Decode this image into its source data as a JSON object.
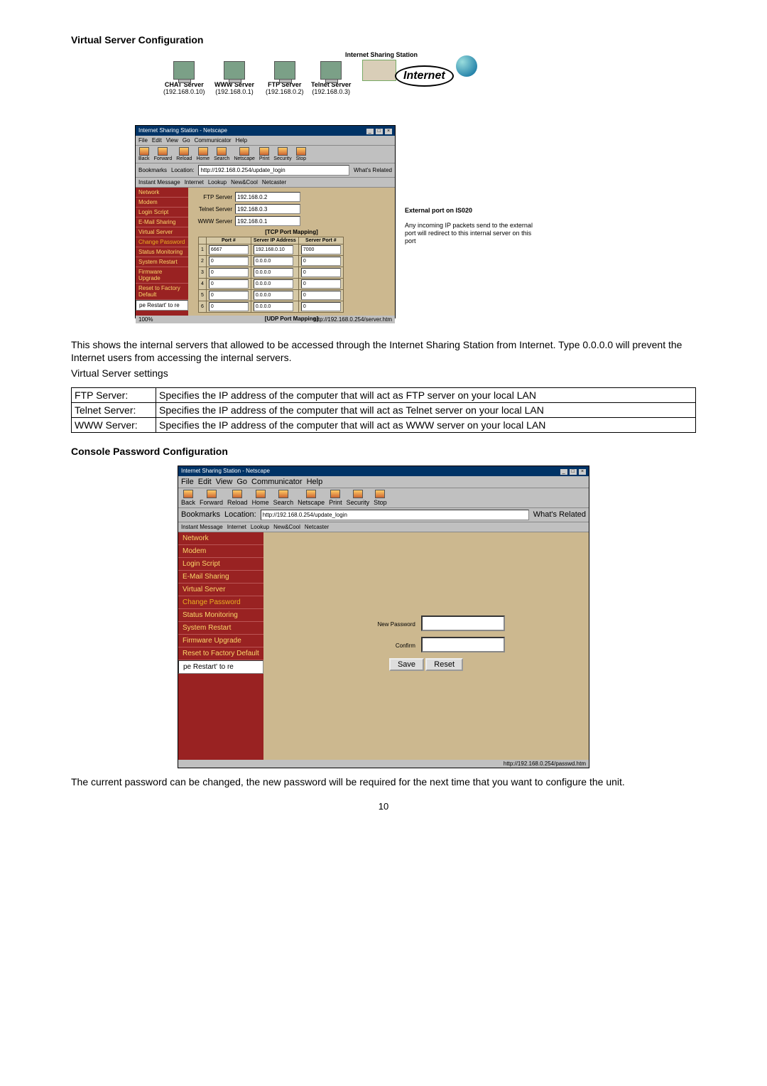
{
  "section1_title": "Virtual Server Configuration",
  "diagram": {
    "iss_label": "Internet Sharing Station",
    "internet_label": "Internet",
    "servers": [
      {
        "name": "CHAT Server",
        "ip": "(192.168.0.10)"
      },
      {
        "name": "WWW Server",
        "ip": "(192.168.0.1)"
      },
      {
        "name": "FTP Server",
        "ip": "(192.168.0.2)"
      },
      {
        "name": "Telnet Server",
        "ip": "(192.168.0.3)"
      }
    ]
  },
  "browser": {
    "title": "Internet Sharing Station - Netscape",
    "win_min": "_",
    "win_max": "□",
    "win_close": "×",
    "menu": [
      "File",
      "Edit",
      "View",
      "Go",
      "Communicator",
      "Help"
    ],
    "toolbar": [
      "Back",
      "Forward",
      "Reload",
      "Home",
      "Search",
      "Netscape",
      "Print",
      "Security",
      "Stop"
    ],
    "bookmarks_label": "Bookmarks",
    "location_label": "Location:",
    "location_value": "http://192.168.0.254/update_login",
    "whats_related": "What's Related",
    "linkbar": [
      "Instant Message",
      "Internet",
      "Lookup",
      "New&Cool",
      "Netcaster"
    ],
    "sidebar": [
      "Network",
      "Modem",
      "Login Script",
      "E-Mail Sharing",
      "Virtual Server",
      "Change Password",
      "Status Monitoring",
      "System Restart",
      "Firmware Upgrade",
      "Reset to Factory Default"
    ],
    "sidebar_note": "pe Restart' to re",
    "panel": {
      "ftp_label": "FTP Server",
      "ftp_value": "192.168.0.2",
      "telnet_label": "Telnet Server",
      "telnet_value": "192.168.0.3",
      "www_label": "WWW Server",
      "www_value": "192.168.0.1",
      "tcp_mapping": "[TCP Port Mapping]",
      "col_port": "Port #",
      "col_ip": "Server IP Address",
      "col_srvport": "Server Port #",
      "rows": [
        {
          "n": "1",
          "port": "6667",
          "ip": "192.168.0.10",
          "sport": "7000"
        },
        {
          "n": "2",
          "port": "0",
          "ip": "0.0.0.0",
          "sport": "0"
        },
        {
          "n": "3",
          "port": "0",
          "ip": "0.0.0.0",
          "sport": "0"
        },
        {
          "n": "4",
          "port": "0",
          "ip": "0.0.0.0",
          "sport": "0"
        },
        {
          "n": "5",
          "port": "0",
          "ip": "0.0.0.0",
          "sport": "0"
        },
        {
          "n": "6",
          "port": "0",
          "ip": "0.0.0.0",
          "sport": "0"
        }
      ],
      "udp_mapping": "[UDP Port Mapping]"
    },
    "status_left": "100%",
    "status_url": "http://192.168.0.254/server.htm"
  },
  "callouts": {
    "ext_port": "External port on IS020",
    "redirect": "Any incoming IP packets send to the external port will redirect to this internal server on this port"
  },
  "para1": "This shows the internal servers that allowed to be accessed through the Internet Sharing Station from Internet. Type 0.0.0.0 will prevent the Internet users from accessing the internal servers.",
  "para1_sub": "Virtual Server settings",
  "settings_table": [
    {
      "k": "FTP Server:",
      "v": "Specifies the IP address of the computer that will act as FTP server on your local LAN"
    },
    {
      "k": "Telnet Server:",
      "v": "Specifies the IP address of the computer that will act as Telnet server on your local LAN"
    },
    {
      "k": "WWW Server:",
      "v": "Specifies the IP address of the computer that will act as WWW server on your local LAN"
    }
  ],
  "section2_title": "Console Password Configuration",
  "browser2": {
    "title": "Internet Sharing Station - Netscape",
    "location_value": "http://192.168.0.254/update_login",
    "sidebar": [
      "Network",
      "Modem",
      "Login Script",
      "E-Mail Sharing",
      "Virtual Server",
      "Change Password",
      "Status Monitoring",
      "System Restart",
      "Firmware Upgrade",
      "Reset to Factory Default"
    ],
    "sidebar_note": "pe Restart' to re",
    "new_password_label": "New Password",
    "confirm_label": "Confirm",
    "save_btn": "Save",
    "reset_btn": "Reset",
    "status_url": "http://192.168.0.254/passwd.htm"
  },
  "para2": "The current password can be changed, the new password will be required for the next time that you want to configure the unit.",
  "page_number": "10"
}
